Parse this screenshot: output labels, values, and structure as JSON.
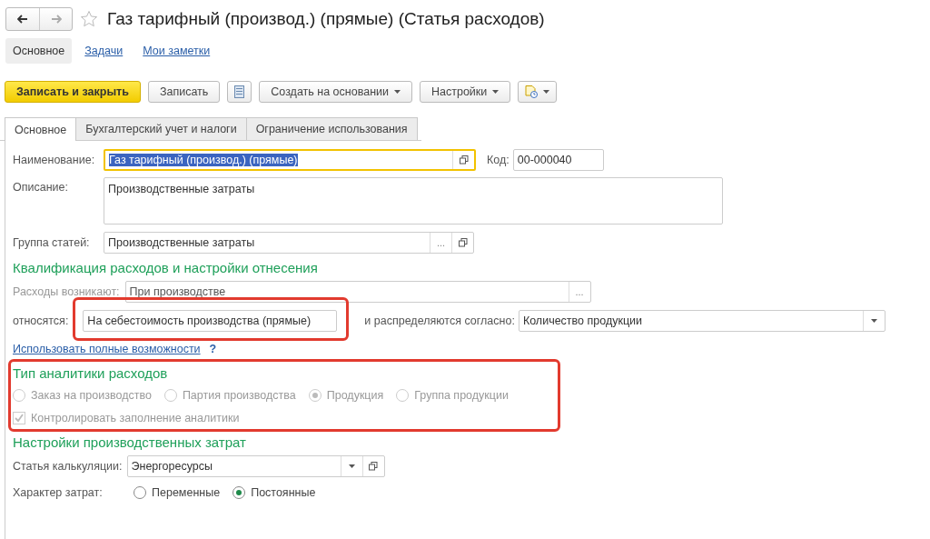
{
  "title": "Газ тарифный (производ.) (прямые) (Статья расходов)",
  "favorite": false,
  "sections": [
    {
      "label": "Основное",
      "selected": true
    },
    {
      "label": "Задачи",
      "selected": false
    },
    {
      "label": "Мои заметки",
      "selected": false
    }
  ],
  "toolbar": [
    {
      "kind": "primary",
      "label": "Записать и закрыть"
    },
    {
      "kind": "plain",
      "label": "Записать"
    },
    {
      "kind": "icon"
    },
    {
      "kind": "dropdown",
      "label": "Создать на основании"
    },
    {
      "kind": "dropdown",
      "label": "Настройки"
    },
    {
      "kind": "iconmenu"
    }
  ],
  "tabs": [
    {
      "label": "Основное",
      "selected": true
    },
    {
      "label": "Бухгалтерский учет и налоги",
      "selected": false
    },
    {
      "label": "Ограничение использования",
      "selected": false
    }
  ],
  "name": {
    "label": "Наименование:",
    "value": "Газ тарифный (производ.) (прямые)",
    "focused": true
  },
  "code": {
    "label": "Код:",
    "value": "00-000040"
  },
  "description": {
    "label": "Описание:",
    "value": "Производственные затраты"
  },
  "group": {
    "label": "Группа статей:",
    "value": "Производственные затраты",
    "choose": "..."
  },
  "qualification": {
    "heading": "Квалификация расходов и настройки отнесения",
    "arise": {
      "label": "Расходы возникают:",
      "value": "При производстве",
      "disabled": true,
      "choose": "..."
    },
    "relate": {
      "label": "относятся:",
      "value": "На себестоимость производства (прямые)",
      "highlighted": true
    },
    "distribute": {
      "label": "и распределяются согласно:",
      "value": "Количество продукции"
    },
    "link": "Использовать полные возможности",
    "help": "?"
  },
  "analytics": {
    "heading": "Тип аналитики расходов",
    "highlighted": true,
    "disabled": true,
    "options": [
      {
        "label": "Заказ на производство",
        "selected": false
      },
      {
        "label": "Партия производства",
        "selected": false
      },
      {
        "label": "Продукция",
        "selected": true
      },
      {
        "label": "Группа продукции",
        "selected": false
      }
    ],
    "control": {
      "label": "Контролировать заполнение аналитики",
      "checked": true
    }
  },
  "production": {
    "heading": "Настройки производственных затрат",
    "item": {
      "label": "Статья калькуляции:",
      "value": "Энергоресурсы"
    },
    "nature": {
      "label": "Характер затрат:",
      "options": [
        {
          "label": "Переменные",
          "selected": false
        },
        {
          "label": "Постоянные",
          "selected": true
        }
      ]
    }
  }
}
